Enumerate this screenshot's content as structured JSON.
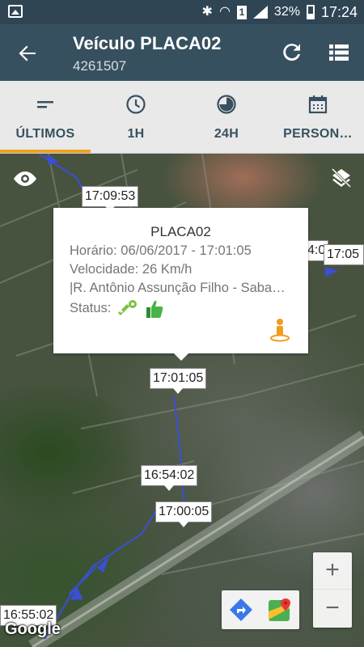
{
  "status_bar": {
    "battery": "32%",
    "time": "17:24",
    "sim_badge": "1"
  },
  "app_bar": {
    "title": "Veículo PLACA02",
    "subtitle": "4261507",
    "icons": [
      "back-arrow-icon",
      "refresh-icon",
      "list-icon"
    ]
  },
  "tabs": [
    {
      "label": "ÚLTIMOS",
      "icon": "latest-icon",
      "selected": true
    },
    {
      "label": "1H",
      "icon": "clock-icon",
      "selected": false
    },
    {
      "label": "24H",
      "icon": "pie-clock-icon",
      "selected": false
    },
    {
      "label": "PERSON…",
      "icon": "calendar-icon",
      "selected": false
    }
  ],
  "map": {
    "time_labels": [
      "17:09:53",
      "17:01:05",
      "16:54:02",
      "17:00:05",
      "16:55:02",
      "4:0",
      "17:05"
    ],
    "info_window": {
      "title": "PLACA02",
      "time_line": "Horário: 06/06/2017 - 17:01:05",
      "speed_line": "Velocidade: 26 Km/h",
      "address_line": "|R. Antônio Assunção Filho - Saba…",
      "status_label": "Status:",
      "status_icons": [
        "ignition-key-icon",
        "thumbs-up-icon"
      ]
    },
    "zoom_in": "+",
    "zoom_out": "−",
    "attribution": "Google"
  },
  "colors": {
    "status_bar": "#2f4554",
    "app_bar": "#37505f",
    "tab_bg": "#e9e9e9",
    "tab_indicator": "#f0a21c",
    "route": "#3a4fd6"
  }
}
